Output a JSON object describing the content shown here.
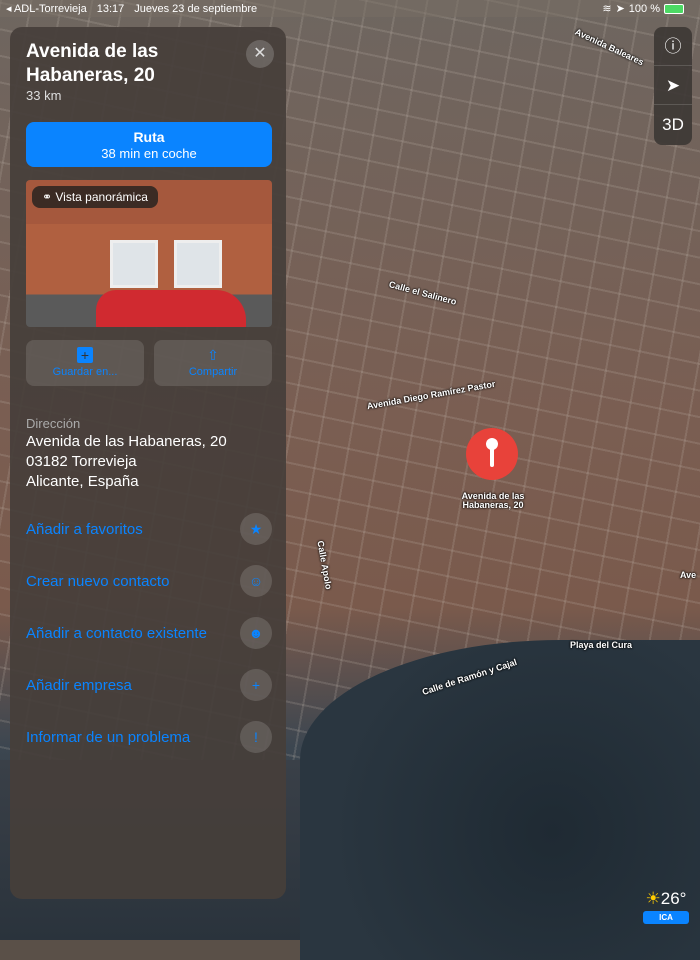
{
  "status": {
    "back": "◂ ADL-Torrevieja",
    "time": "13:17",
    "date": "Jueves 23 de septiembre",
    "battery": "100 %"
  },
  "place": {
    "title": "Avenida de las Habaneras, 20",
    "distance": "33 km"
  },
  "route": {
    "label": "Ruta",
    "detail": "38 min en coche"
  },
  "photo": {
    "badge": "Vista panorámica"
  },
  "actions": [
    {
      "label": "Guardar en..."
    },
    {
      "label": "Compartir"
    }
  ],
  "address": {
    "label": "Dirección",
    "line1": "Avenida de las Habaneras, 20",
    "line2": "03182 Torrevieja",
    "line3": "Alicante, España"
  },
  "rows": [
    {
      "label": "Añadir a favoritos",
      "icon": "★"
    },
    {
      "label": "Crear nuevo contacto",
      "icon": "☺"
    },
    {
      "label": "Añadir a contacto existente",
      "icon": "☻"
    },
    {
      "label": "Añadir empresa",
      "icon": "+"
    },
    {
      "label": "Informar de un problema",
      "icon": "!"
    }
  ],
  "map": {
    "labels": [
      "Calle el Salinero",
      "Avenida Diego Ramírez Pastor",
      "Avenida de las Habaneras, 20",
      "Calle Apolo",
      "Playa del Cura",
      "Calle de Ramón y Cajal",
      "Avenida Baleares",
      "Ave"
    ],
    "controls": {
      "info": "ⓘ",
      "locate": "➤",
      "view": "3D"
    }
  },
  "weather": {
    "temp": "26°",
    "aqi": "ICA"
  }
}
